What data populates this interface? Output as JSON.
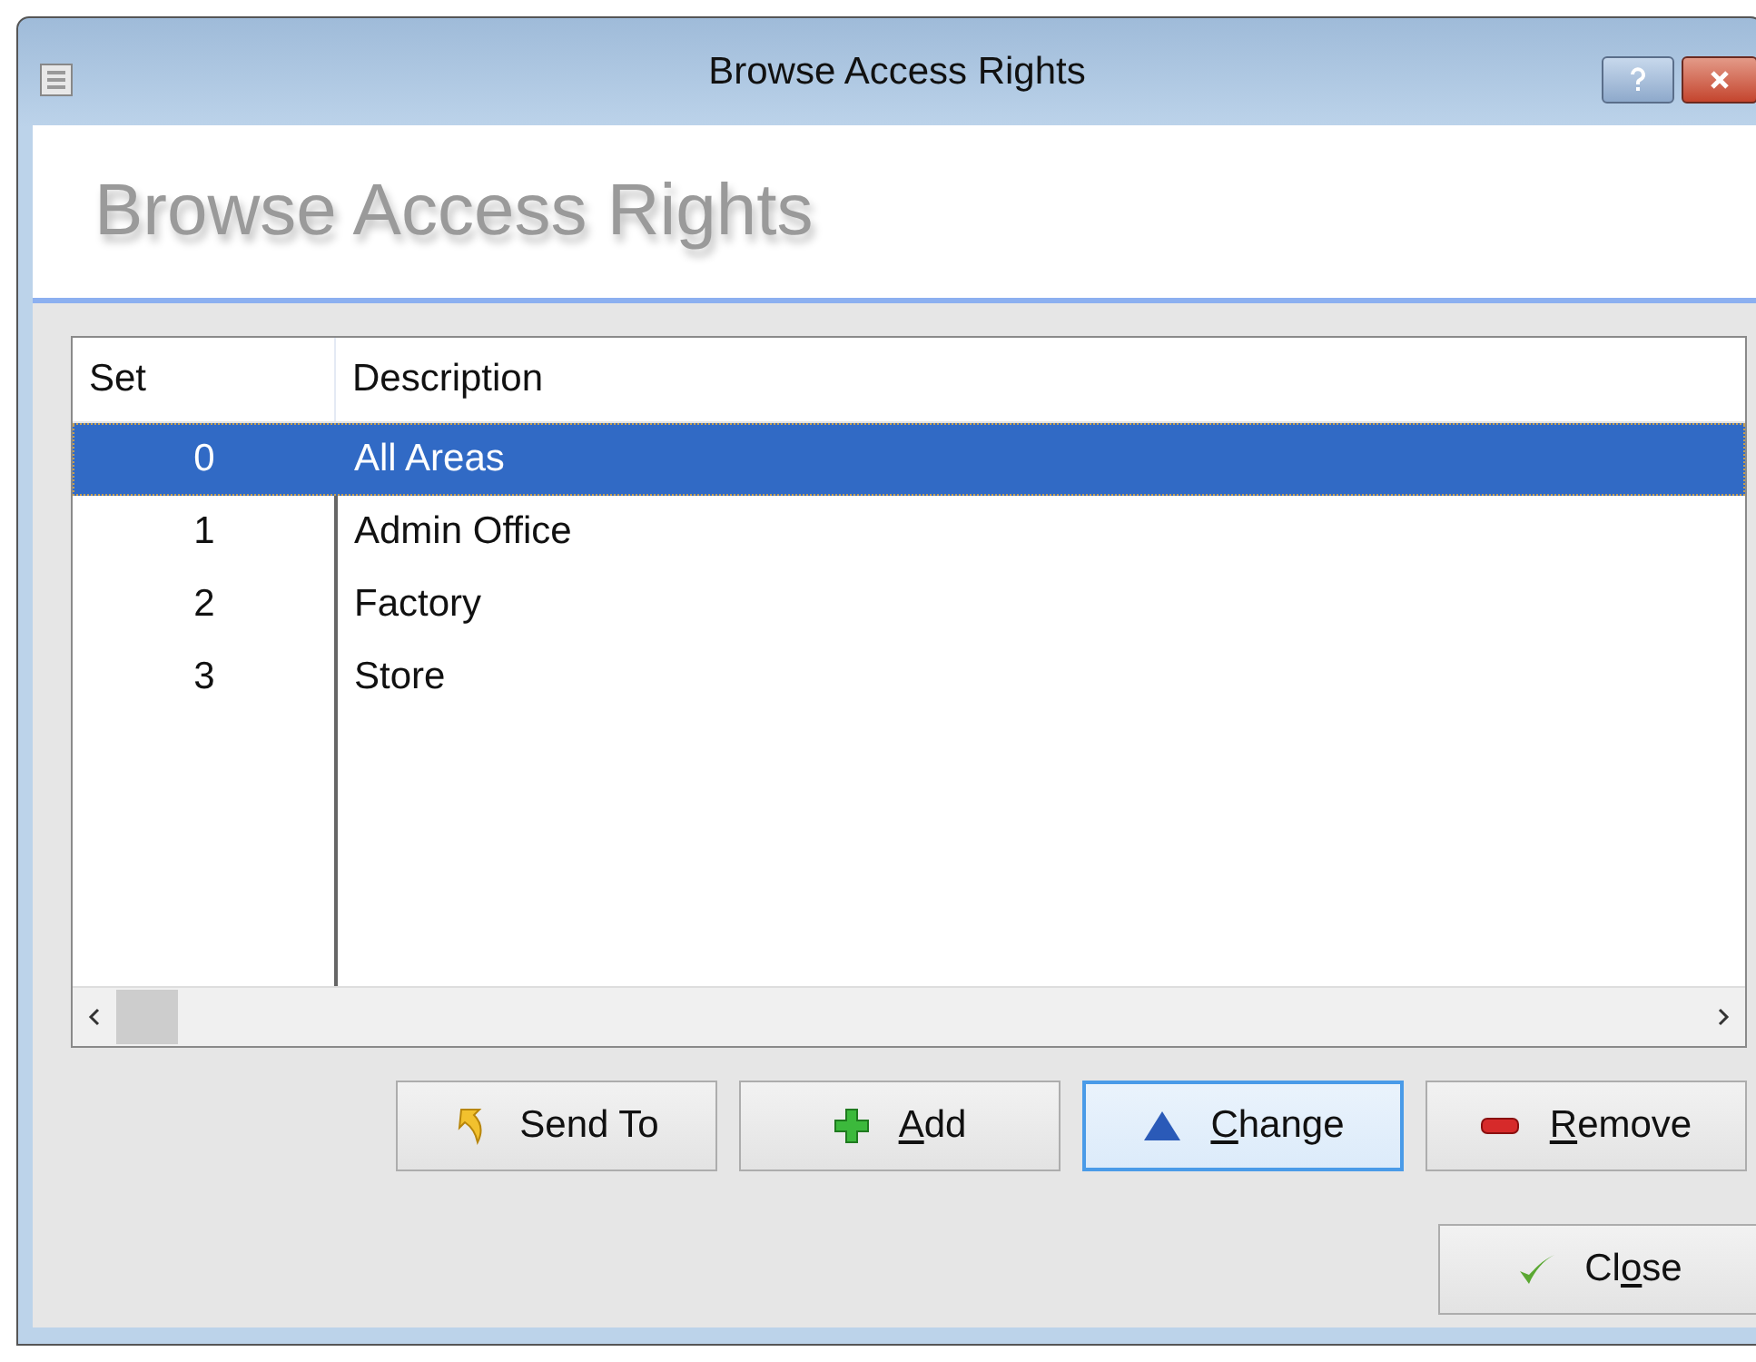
{
  "window": {
    "title": "Browse Access Rights"
  },
  "header": {
    "title": "Browse Access Rights"
  },
  "table": {
    "columns": [
      "Set",
      "Description"
    ],
    "rows": [
      {
        "set": "0",
        "description": "All Areas",
        "selected": true
      },
      {
        "set": "1",
        "description": "Admin Office",
        "selected": false
      },
      {
        "set": "2",
        "description": "Factory",
        "selected": false
      },
      {
        "set": "3",
        "description": "Store",
        "selected": false
      }
    ]
  },
  "buttons": [
    {
      "kind": "send",
      "post": "Send To",
      "focused": false
    },
    {
      "kind": "add",
      "key": "A",
      "post": "dd",
      "focused": false
    },
    {
      "kind": "change",
      "key": "C",
      "post": "hange",
      "focused": true
    },
    {
      "kind": "remove",
      "key": "R",
      "post": "emove",
      "focused": false
    }
  ],
  "close_button": {
    "kind": "close",
    "pre": "Cl",
    "key": "o",
    "post": "se",
    "focused": false
  }
}
